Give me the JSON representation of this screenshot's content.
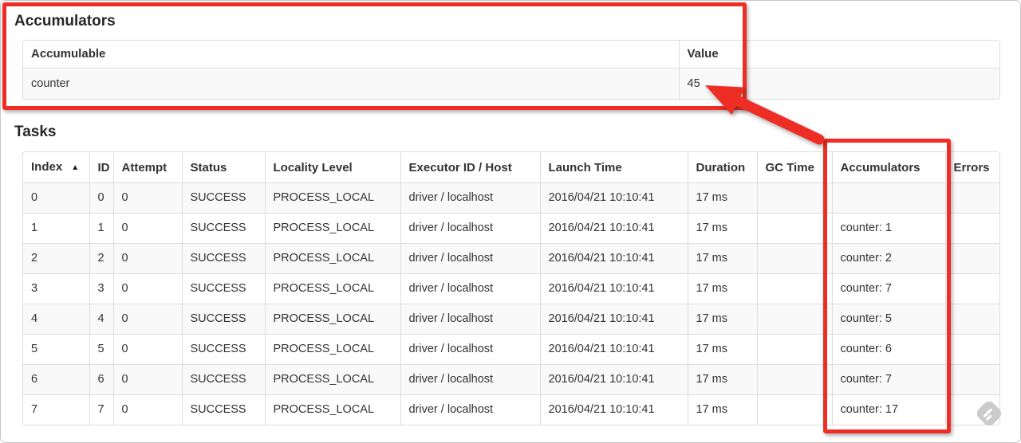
{
  "annotation_color": "#ee2e24",
  "accumulators_section": {
    "title": "Accumulators",
    "table": {
      "headers": [
        "Accumulable",
        "Value"
      ],
      "rows": [
        [
          "counter",
          "45"
        ]
      ]
    }
  },
  "tasks_section": {
    "title": "Tasks",
    "table": {
      "headers": [
        "Index",
        "ID",
        "Attempt",
        "Status",
        "Locality Level",
        "Executor ID / Host",
        "Launch Time",
        "Duration",
        "GC Time",
        "Accumulators",
        "Errors"
      ],
      "sort": {
        "column": "Index",
        "direction": "ascending",
        "glyph": "▲"
      },
      "rows": [
        [
          "0",
          "0",
          "0",
          "SUCCESS",
          "PROCESS_LOCAL",
          "driver / localhost",
          "2016/04/21 10:10:41",
          "17 ms",
          "",
          "",
          ""
        ],
        [
          "1",
          "1",
          "0",
          "SUCCESS",
          "PROCESS_LOCAL",
          "driver / localhost",
          "2016/04/21 10:10:41",
          "17 ms",
          "",
          "counter: 1",
          ""
        ],
        [
          "2",
          "2",
          "0",
          "SUCCESS",
          "PROCESS_LOCAL",
          "driver / localhost",
          "2016/04/21 10:10:41",
          "17 ms",
          "",
          "counter: 2",
          ""
        ],
        [
          "3",
          "3",
          "0",
          "SUCCESS",
          "PROCESS_LOCAL",
          "driver / localhost",
          "2016/04/21 10:10:41",
          "17 ms",
          "",
          "counter: 7",
          ""
        ],
        [
          "4",
          "4",
          "0",
          "SUCCESS",
          "PROCESS_LOCAL",
          "driver / localhost",
          "2016/04/21 10:10:41",
          "17 ms",
          "",
          "counter: 5",
          ""
        ],
        [
          "5",
          "5",
          "0",
          "SUCCESS",
          "PROCESS_LOCAL",
          "driver / localhost",
          "2016/04/21 10:10:41",
          "17 ms",
          "",
          "counter: 6",
          ""
        ],
        [
          "6",
          "6",
          "0",
          "SUCCESS",
          "PROCESS_LOCAL",
          "driver / localhost",
          "2016/04/21 10:10:41",
          "17 ms",
          "",
          "counter: 7",
          ""
        ],
        [
          "7",
          "7",
          "0",
          "SUCCESS",
          "PROCESS_LOCAL",
          "driver / localhost",
          "2016/04/21 10:10:41",
          "17 ms",
          "",
          "counter: 17",
          ""
        ]
      ]
    }
  }
}
